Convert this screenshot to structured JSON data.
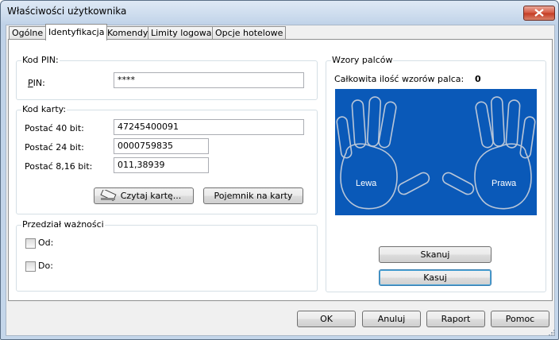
{
  "window": {
    "title": "Właściwości użytkownika"
  },
  "tabs": [
    "Ogólne",
    "Identyfikacja",
    "Komendy",
    "Limity logowań",
    "Opcje hotelowe"
  ],
  "pin": {
    "group_title": "Kod PIN:",
    "label": "PIN:",
    "value": "****"
  },
  "card": {
    "group_title": "Kod karty:",
    "label_40": "Postać 40 bit:",
    "value_40": "47245400091",
    "label_24": "Postać 24 bit:",
    "value_24": "0000759835",
    "label_816": "Postać 8,16 bit:",
    "value_816": "011,38939",
    "read_button": "Czytaj kartę...",
    "container_button": "Pojemnik na karty"
  },
  "validity": {
    "group_title": "Przedział ważności",
    "from_label": "Od:",
    "to_label": "Do:"
  },
  "fingerprints": {
    "group_title": "Wzory palców",
    "total_label": "Całkowita ilość wzorów palca:",
    "total_value": "0",
    "left_hand": "Lewa",
    "right_hand": "Prawa",
    "scan_button": "Skanuj",
    "delete_button": "Kasuj"
  },
  "footer": {
    "ok": "OK",
    "cancel": "Anuluj",
    "report": "Raport",
    "help": "Pomoc"
  },
  "colors": {
    "hand_panel_bg": "#0a59b8",
    "hand_outline": "#b9c6d8"
  }
}
